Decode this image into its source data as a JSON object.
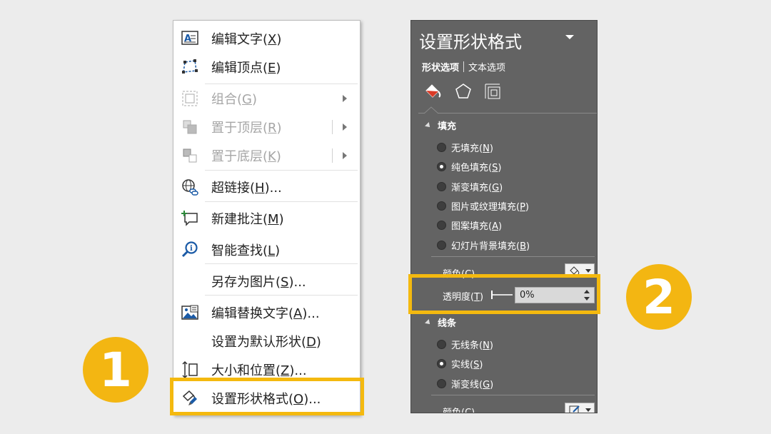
{
  "context_menu": {
    "items": [
      {
        "text": "编辑文字(",
        "key": "X",
        "suffix": ")",
        "icon": "edit-text-icon",
        "disabled": false
      },
      {
        "text": "编辑顶点(",
        "key": "E",
        "suffix": ")",
        "icon": "edit-points-icon",
        "disabled": false
      },
      {
        "text": "组合(",
        "key": "G",
        "suffix": ")",
        "icon": "group-icon",
        "disabled": true
      },
      {
        "text": "置于顶层(",
        "key": "R",
        "suffix": ")",
        "icon": "bring-to-front-icon",
        "disabled": true
      },
      {
        "text": "置于底层(",
        "key": "K",
        "suffix": ")",
        "icon": "send-to-back-icon",
        "disabled": true
      },
      {
        "text": "超链接(",
        "key": "H",
        "suffix": ")...",
        "icon": "hyperlink-icon",
        "disabled": false
      },
      {
        "text": "新建批注(",
        "key": "M",
        "suffix": ")",
        "icon": "new-comment-icon",
        "disabled": false
      },
      {
        "text": "智能查找(",
        "key": "L",
        "suffix": ")",
        "icon": "smart-lookup-icon",
        "disabled": false
      },
      {
        "text": "另存为图片(",
        "key": "S",
        "suffix": ")...",
        "icon": "",
        "disabled": false
      },
      {
        "text": "编辑替换文字(",
        "key": "A",
        "suffix": ")...",
        "icon": "alt-text-icon",
        "disabled": false
      },
      {
        "text": "设置为默认形状(",
        "key": "D",
        "suffix": ")",
        "icon": "",
        "disabled": false
      },
      {
        "text": "大小和位置(",
        "key": "Z",
        "suffix": ")...",
        "icon": "size-position-icon",
        "disabled": false
      },
      {
        "text": "设置形状格式(",
        "key": "O",
        "suffix": ")...",
        "icon": "format-shape-icon",
        "disabled": false
      }
    ]
  },
  "panel": {
    "title": "设置形状格式",
    "tab_shape": "形状选项",
    "tab_text": "文本选项",
    "fill": {
      "header": "填充",
      "options": [
        {
          "text": "无填充(",
          "key": "N",
          "suffix": ")",
          "checked": false
        },
        {
          "text": "纯色填充(",
          "key": "S",
          "suffix": ")",
          "checked": true
        },
        {
          "text": "渐变填充(",
          "key": "G",
          "suffix": ")",
          "checked": false
        },
        {
          "text": "图片或纹理填充(",
          "key": "P",
          "suffix": ")",
          "checked": false
        },
        {
          "text": "图案填充(",
          "key": "A",
          "suffix": ")",
          "checked": false
        },
        {
          "text": "幻灯片背景填充(",
          "key": "B",
          "suffix": ")",
          "checked": false
        }
      ],
      "color_label": "颜色(C)",
      "transparency_label": "透明度(",
      "transparency_key": "T",
      "transparency_suffix": ")",
      "transparency_value": "0%"
    },
    "line": {
      "header": "线条",
      "options": [
        {
          "text": "无线条(",
          "key": "N",
          "suffix": ")",
          "checked": false
        },
        {
          "text": "实线(",
          "key": "S",
          "suffix": ")",
          "checked": true
        },
        {
          "text": "渐变线(",
          "key": "G",
          "suffix": ")",
          "checked": false
        }
      ],
      "color_label": "颜色(C)"
    }
  },
  "badges": {
    "one": "1",
    "two": "2"
  },
  "colors": {
    "highlight": "#f4b90f",
    "badge": "#f3b612",
    "panel_bg": "#636363"
  }
}
